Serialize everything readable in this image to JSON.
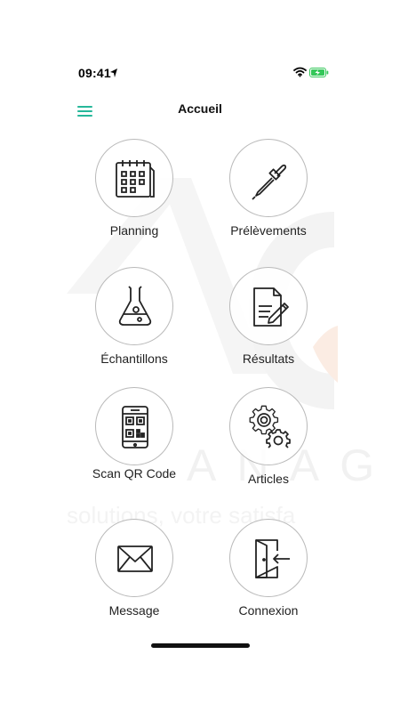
{
  "status": {
    "time": "09:41"
  },
  "header": {
    "title": "Accueil"
  },
  "watermark": {
    "brand": "A N A G E",
    "tagline": "solutions, votre satisfa"
  },
  "tiles": [
    {
      "label": "Planning",
      "icon": "calendar-icon"
    },
    {
      "label": "Prélèvements",
      "icon": "pipette-icon"
    },
    {
      "label": "Échantillons",
      "icon": "flask-icon"
    },
    {
      "label": "Résultats",
      "icon": "document-pen-icon"
    },
    {
      "label": "Scan QR Code",
      "icon": "qr-phone-icon"
    },
    {
      "label": "Articles",
      "icon": "gears-icon"
    },
    {
      "label": "Message",
      "icon": "envelope-icon"
    },
    {
      "label": "Connexion",
      "icon": "login-door-icon"
    }
  ],
  "colors": {
    "accent": "#26b79a",
    "battery": "#34c759",
    "watermark": "#f2f2f2",
    "watermark_accent": "#fbeee6"
  }
}
